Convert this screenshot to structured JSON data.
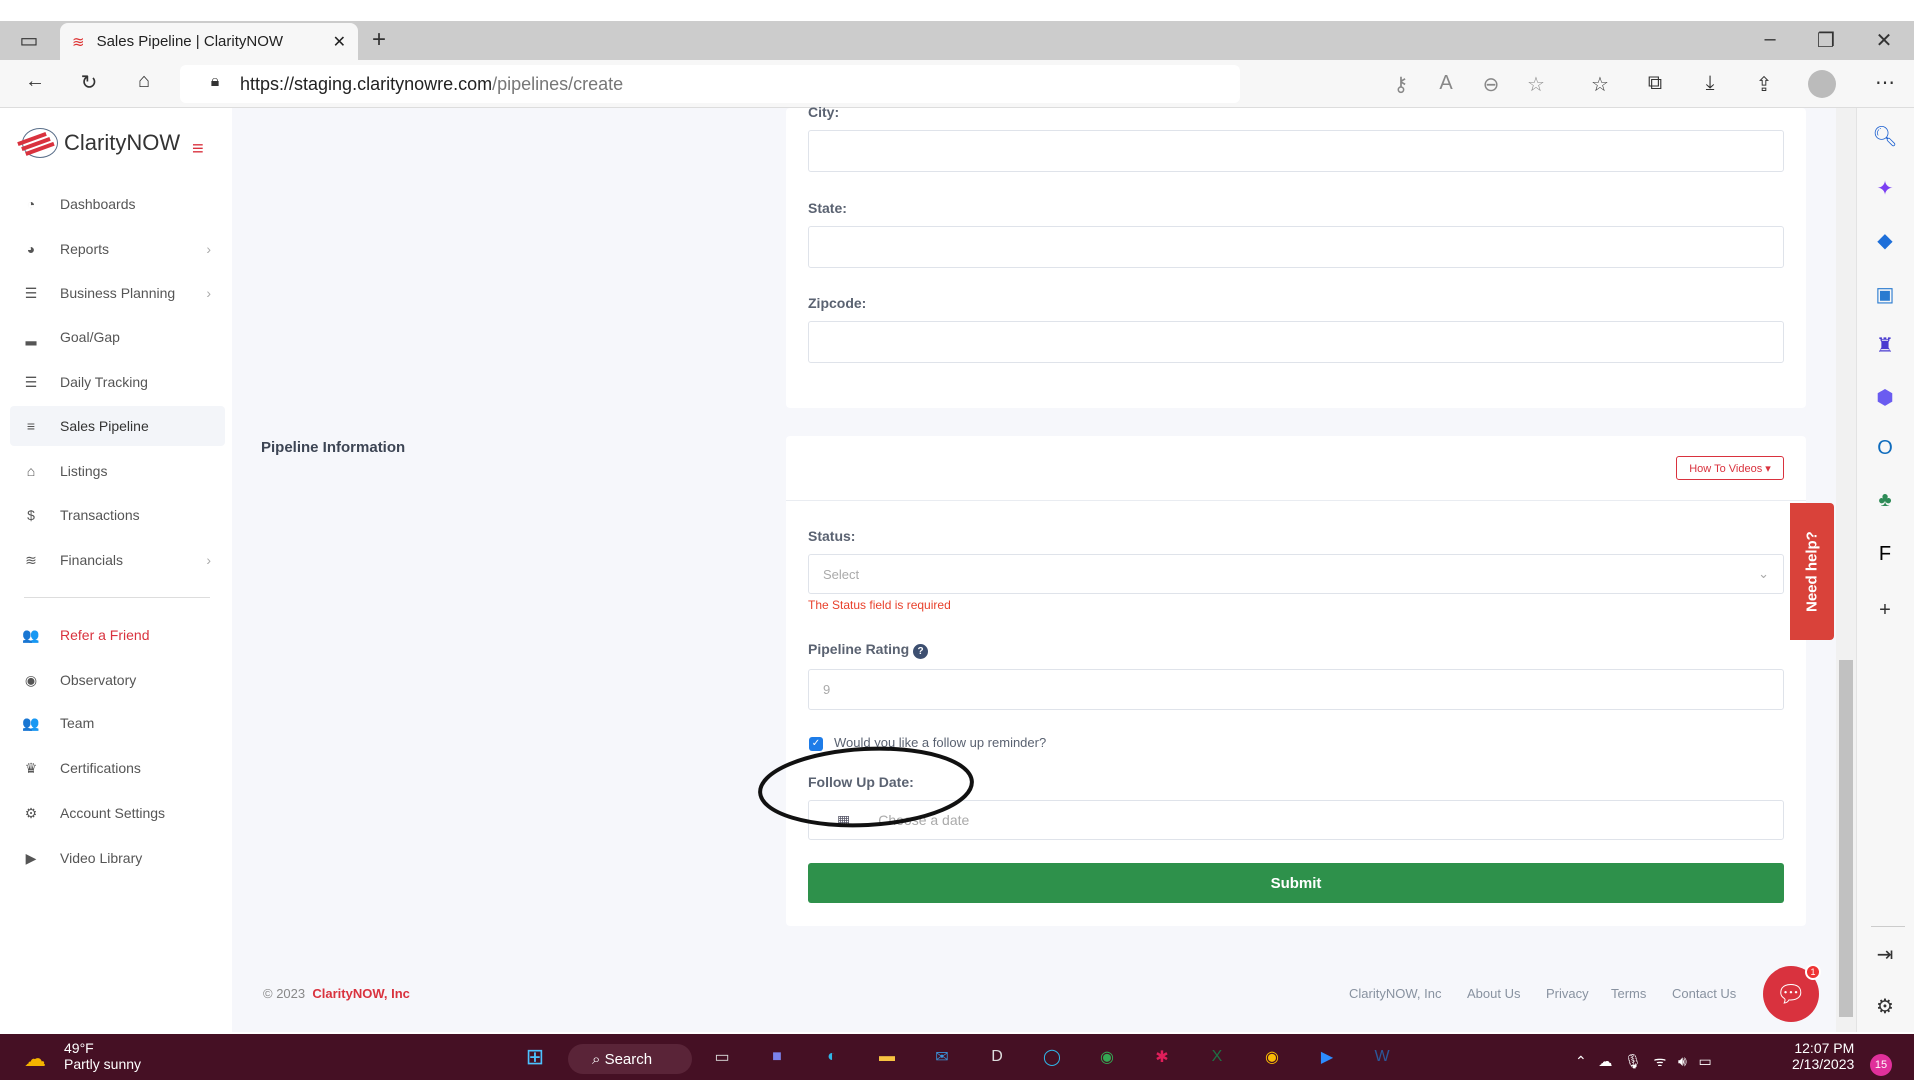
{
  "browser": {
    "tab_title": "Sales Pipeline | ClarityNOW",
    "url_host": "https://staging.claritynowre.com",
    "url_path": "/pipelines/create",
    "new_tab": "+"
  },
  "sidebar": {
    "brand": "ClarityNOW",
    "items": [
      {
        "label": "Dashboards",
        "icon": "gauge-icon",
        "glyph": "◔"
      },
      {
        "label": "Reports",
        "icon": "pie-chart-icon",
        "glyph": "◕",
        "chevron": "›"
      },
      {
        "label": "Business Planning",
        "icon": "checklist-icon",
        "glyph": "☰",
        "chevron": "›"
      },
      {
        "label": "Goal/Gap",
        "icon": "signal-bars-icon",
        "glyph": "▂"
      },
      {
        "label": "Daily Tracking",
        "icon": "list-icon",
        "glyph": "☰"
      },
      {
        "label": "Sales Pipeline",
        "icon": "menu-icon",
        "glyph": "≡",
        "active": true
      },
      {
        "label": "Listings",
        "icon": "home-icon",
        "glyph": "⌂"
      },
      {
        "label": "Transactions",
        "icon": "dollar-icon",
        "glyph": "$"
      },
      {
        "label": "Financials",
        "icon": "coins-icon",
        "glyph": "≋",
        "chevron": "›"
      },
      {
        "label": "Refer a Friend",
        "icon": "users-icon",
        "glyph": "👥",
        "accent": true
      },
      {
        "label": "Observatory",
        "icon": "eye-icon",
        "glyph": "◉"
      },
      {
        "label": "Team",
        "icon": "team-icon",
        "glyph": "👥"
      },
      {
        "label": "Certifications",
        "icon": "crown-icon",
        "glyph": "♛"
      },
      {
        "label": "Account Settings",
        "icon": "gear-icon",
        "glyph": "⚙"
      },
      {
        "label": "Video Library",
        "icon": "play-circle-icon",
        "glyph": "▶"
      }
    ]
  },
  "form": {
    "city_label": "City:",
    "state_label": "State:",
    "zipcode_label": "Zipcode:",
    "section_title": "Pipeline Information",
    "how_to_videos": "How To Videos ▾",
    "status_label": "Status:",
    "status_placeholder": "Select",
    "status_error": "The Status field is required",
    "rating_label": "Pipeline Rating",
    "rating_value": "9",
    "reminder_label": "Would you like a follow up reminder?",
    "reminder_checked": true,
    "followup_label": "Follow Up Date:",
    "followup_placeholder": "Choose a date",
    "submit": "Submit"
  },
  "footer": {
    "copyright": "© 2023",
    "company": "ClarityNOW, Inc",
    "links": [
      "ClarityNOW, Inc",
      "About Us",
      "Privacy",
      "Terms",
      "Contact Us"
    ]
  },
  "help": {
    "need_help": "Need help?",
    "chat_badge": "1"
  },
  "taskbar": {
    "temp": "49°F",
    "weather": "Partly sunny",
    "search": "Search",
    "time": "12:07 PM",
    "date": "2/13/2023",
    "notifications": "15"
  },
  "colors": {
    "accent": "#d9323e",
    "submit": "#2e914b",
    "error": "#e8412c",
    "taskbar": "#451024"
  }
}
